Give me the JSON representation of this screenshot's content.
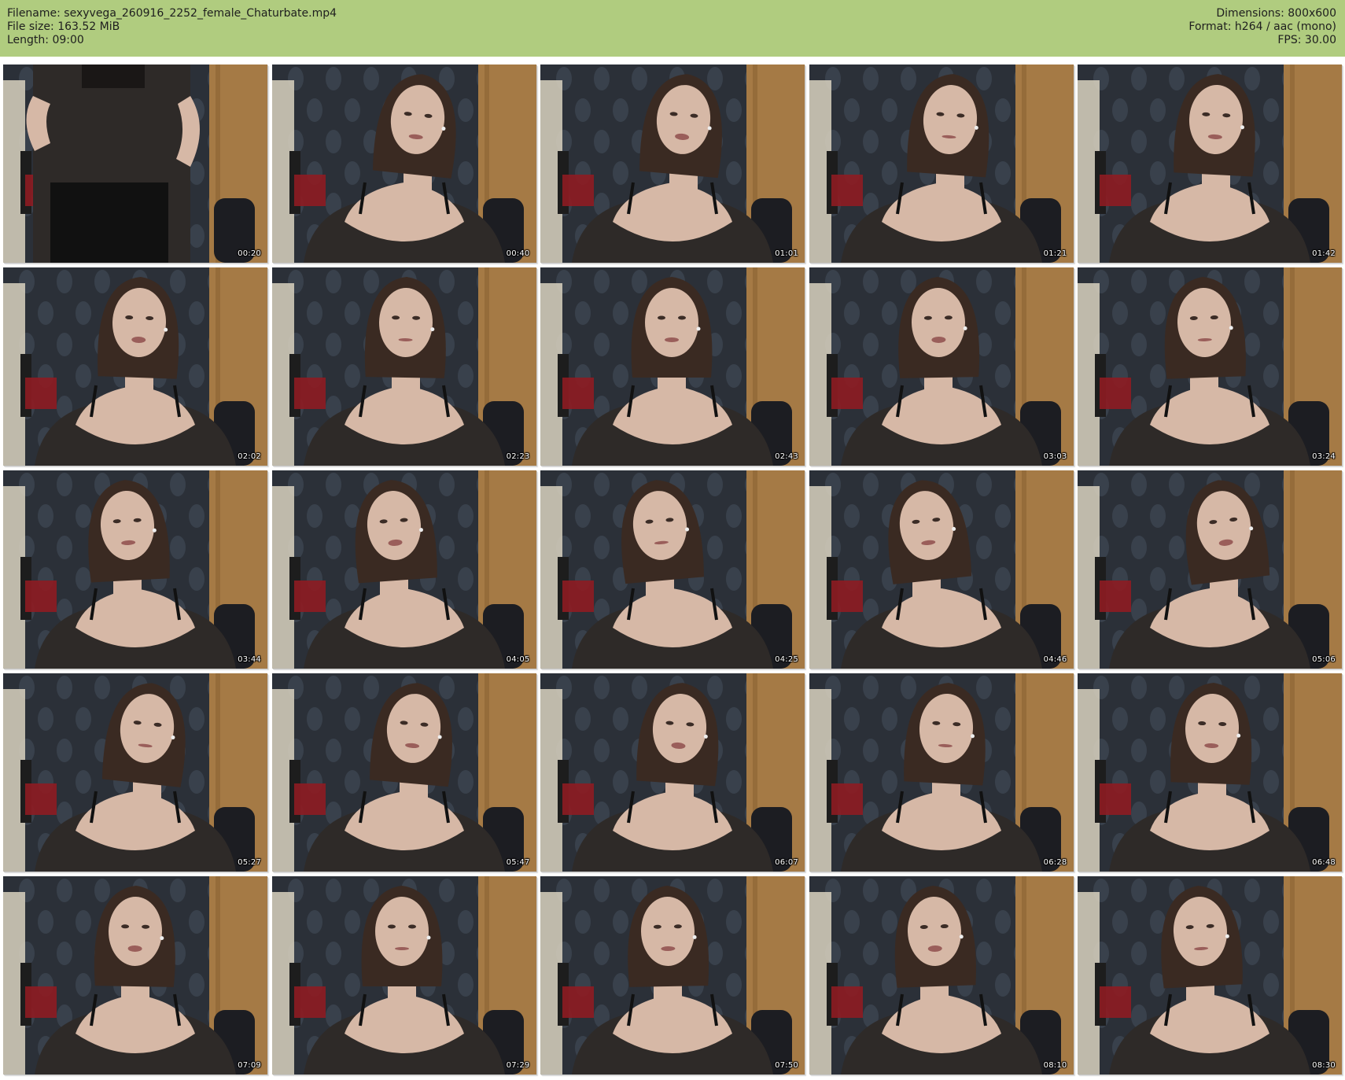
{
  "header": {
    "filename": "Filename: sexyvega_260916_2252_female_Chaturbate.mp4",
    "filesize": "File size: 163.52 MiB",
    "length": "Length: 09:00",
    "dimensions": "Dimensions: 800x600",
    "format": "Format: h264 / aac (mono)",
    "fps": "FPS: 30.00"
  },
  "thumbnails": [
    {
      "time": "00:20"
    },
    {
      "time": "00:40"
    },
    {
      "time": "01:01"
    },
    {
      "time": "01:21"
    },
    {
      "time": "01:42"
    },
    {
      "time": "02:02"
    },
    {
      "time": "02:23"
    },
    {
      "time": "02:43"
    },
    {
      "time": "03:03"
    },
    {
      "time": "03:24"
    },
    {
      "time": "03:44"
    },
    {
      "time": "04:05"
    },
    {
      "time": "04:25"
    },
    {
      "time": "04:46"
    },
    {
      "time": "05:06"
    },
    {
      "time": "05:27"
    },
    {
      "time": "05:47"
    },
    {
      "time": "06:07"
    },
    {
      "time": "06:28"
    },
    {
      "time": "06:48"
    },
    {
      "time": "07:09"
    },
    {
      "time": "07:29"
    },
    {
      "time": "07:50"
    },
    {
      "time": "08:10"
    },
    {
      "time": "08:30"
    }
  ],
  "colors": {
    "header_bg": "#b0cc7f",
    "wallpaper": "#2b3038",
    "door": "#a57a45",
    "top_fabric": "#2e2a28",
    "skin": "#d6b8a6",
    "hair": "#3a2a22",
    "red_accent": "#8e1c22"
  }
}
